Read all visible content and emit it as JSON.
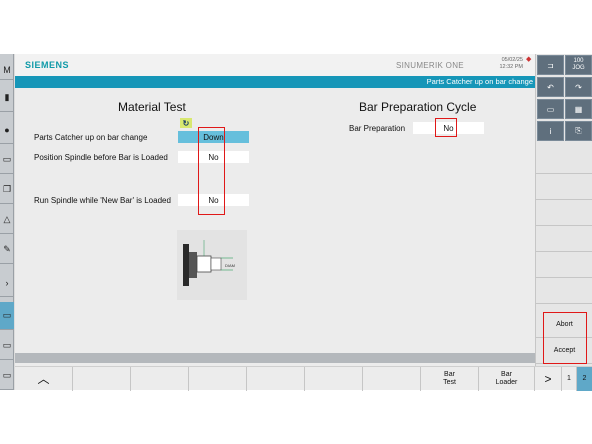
{
  "header": {
    "brand": "SIEMENS",
    "product": "SINUMERIK ONE",
    "date": "05/02/25",
    "time": "12:32 PM",
    "title": "Parts Catcher up on bar change"
  },
  "material_test": {
    "title": "Material Test",
    "rows": [
      {
        "label": "Parts Catcher up on bar change",
        "value": "Down"
      },
      {
        "label": "Position Spindle before Bar is Loaded",
        "value": "No"
      },
      {
        "label": "Run Spindle while 'New Bar' is Loaded",
        "value": "No"
      }
    ],
    "diagram_label": "DIAM"
  },
  "bar_prep": {
    "title": "Bar Preparation Cycle",
    "label": "Bar Preparation",
    "value": "No"
  },
  "right_top": {
    "counter": "100",
    "sub": "JOG",
    "info": "i"
  },
  "vertical_softkeys": [
    "Abort",
    "Accept"
  ],
  "horizontal_softkeys": {
    "bar_test": [
      "Bar",
      "Test"
    ],
    "bar_loader": [
      "Bar",
      "Loader"
    ],
    "page_next": ">",
    "page_1": "1",
    "page_2": "2"
  },
  "colors": {
    "accent": "#1696b8",
    "highlight_field": "#66bfdc",
    "markup": "#e01818"
  }
}
